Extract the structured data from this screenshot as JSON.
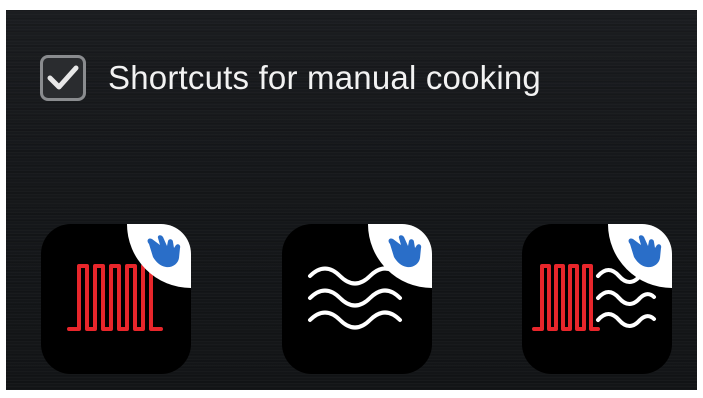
{
  "manual_cooking": {
    "checkbox_checked": true,
    "label": "Shortcuts for manual cooking"
  },
  "shortcuts": [
    {
      "icon": "heating-element-icon"
    },
    {
      "icon": "steam-icon"
    },
    {
      "icon": "heating-steam-icon"
    }
  ],
  "colors": {
    "heating": "#e8262b",
    "steam": "#ffffff",
    "hand": "#2a6ec8",
    "checkbox_border": "#8a8c8f"
  }
}
